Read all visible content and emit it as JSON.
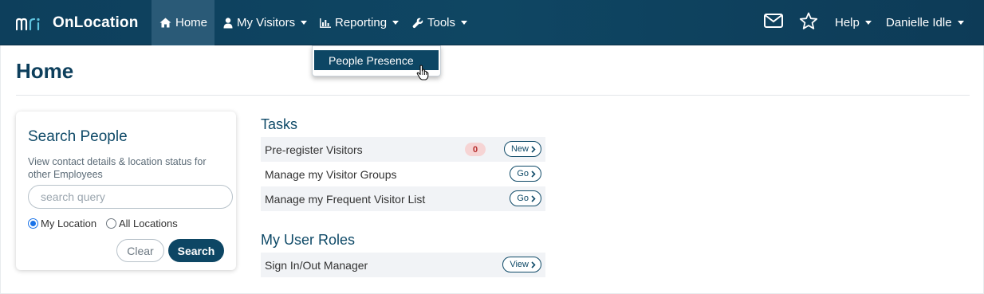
{
  "app": {
    "brand_mark": "mri",
    "brand_name": "OnLocation"
  },
  "nav": {
    "items": [
      {
        "label": "Home",
        "icon": "home-icon",
        "active": true
      },
      {
        "label": "My Visitors",
        "icon": "user-icon",
        "has_caret": true
      },
      {
        "label": "Reporting",
        "icon": "bar-chart-icon",
        "has_caret": true
      },
      {
        "label": "Tools",
        "icon": "wrench-icon",
        "has_caret": true
      }
    ],
    "help_label": "Help",
    "user_name": "Danielle Idle"
  },
  "reporting_menu": {
    "items": [
      "People Presence"
    ]
  },
  "page": {
    "title": "Home"
  },
  "search": {
    "title": "Search People",
    "description": "View contact details & location status for other Employees",
    "placeholder": "search query",
    "value": "",
    "radio_my_location": "My Location",
    "radio_all_locations": "All Locations",
    "selected_scope": "My Location",
    "clear_label": "Clear",
    "search_label": "Search"
  },
  "tasks": {
    "title": "Tasks",
    "rows": [
      {
        "label": "Pre-register Visitors",
        "badge": "0",
        "action": "New"
      },
      {
        "label": "Manage my Visitor Groups",
        "action": "Go"
      },
      {
        "label": "Manage my Frequent Visitor List",
        "action": "Go"
      }
    ]
  },
  "roles": {
    "title": "My User Roles",
    "rows": [
      {
        "label": "Sign In/Out Manager",
        "action": "View"
      }
    ]
  },
  "colors": {
    "nav_bg": "#0d3f5c",
    "accent": "#0d4664",
    "badge_bg": "#f6d4d4",
    "badge_text": "#b52b2b"
  }
}
